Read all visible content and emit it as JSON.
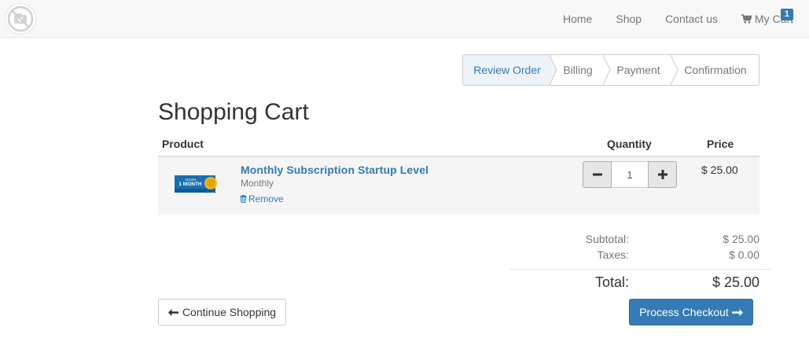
{
  "navbar": {
    "logo_icon": "camera-off-icon",
    "links": {
      "home": "Home",
      "shop": "Shop",
      "contact": "Contact us",
      "cart": "My Cart"
    },
    "cart_icon": "shopping-cart-icon",
    "cart_count": "1"
  },
  "steps": {
    "review": "Review Order",
    "billing": "Billing",
    "payment": "Payment",
    "confirmation": "Confirmation",
    "active": "review"
  },
  "page_title": "Shopping Cart",
  "table": {
    "headers": {
      "product": "Product",
      "quantity": "Quantity",
      "price": "Price"
    },
    "items": [
      {
        "name": "Monthly Subscription Startup Level",
        "term": "Monthly",
        "remove_label": "Remove",
        "quantity": "1",
        "price": "$ 25.00",
        "thumb_icon": "subscription-badge-icon"
      }
    ]
  },
  "totals": {
    "subtotal_label": "Subtotal:",
    "subtotal_value": "$ 25.00",
    "taxes_label": "Taxes:",
    "taxes_value": "$ 0.00",
    "total_label": "Total:",
    "total_value": "$ 25.00"
  },
  "buttons": {
    "continue": "Continue Shopping",
    "checkout": "Process Checkout"
  },
  "colors": {
    "primary": "#337ab7",
    "navbar_bg": "#f8f8f8",
    "row_bg": "#f5f5f5",
    "active_step_bg": "#eef3f9"
  }
}
